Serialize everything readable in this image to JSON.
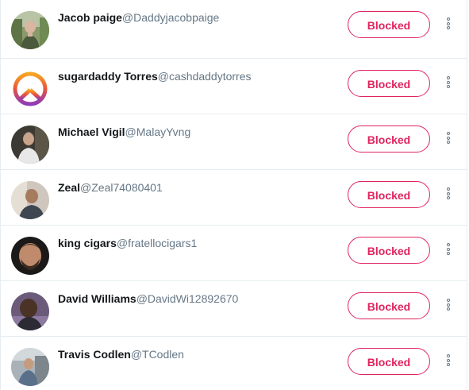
{
  "colors": {
    "accent": "#e0245e",
    "name_text": "#14171a",
    "handle_text": "#657786",
    "divider": "#e6ecf0"
  },
  "blocked_accounts": [
    {
      "name": "Jacob paige",
      "handle": "@Daddyjacobpaige",
      "button_label": "Blocked",
      "avatar": "avatar-photo-man-outdoors"
    },
    {
      "name": "sugardaddy Torres",
      "handle": "@cashdaddytorres",
      "button_label": "Blocked",
      "avatar": "peace-sign-icon"
    },
    {
      "name": "Michael Vigil",
      "handle": "@MalayYvng",
      "button_label": "Blocked",
      "avatar": "avatar-photo-man-gray-hair"
    },
    {
      "name": "Zeal",
      "handle": "@Zeal74080401",
      "button_label": "Blocked",
      "avatar": "avatar-photo-man-indoors"
    },
    {
      "name": "king cigars",
      "handle": "@fratellocigars1",
      "button_label": "Blocked",
      "avatar": "avatar-photo-bearded-man"
    },
    {
      "name": "David Williams",
      "handle": "@DavidWi12892670",
      "button_label": "Blocked",
      "avatar": "avatar-photo-man-dark"
    },
    {
      "name": "Travis Codlen",
      "handle": "@TCodlen",
      "button_label": "Blocked",
      "avatar": "avatar-photo-man-seated"
    }
  ]
}
